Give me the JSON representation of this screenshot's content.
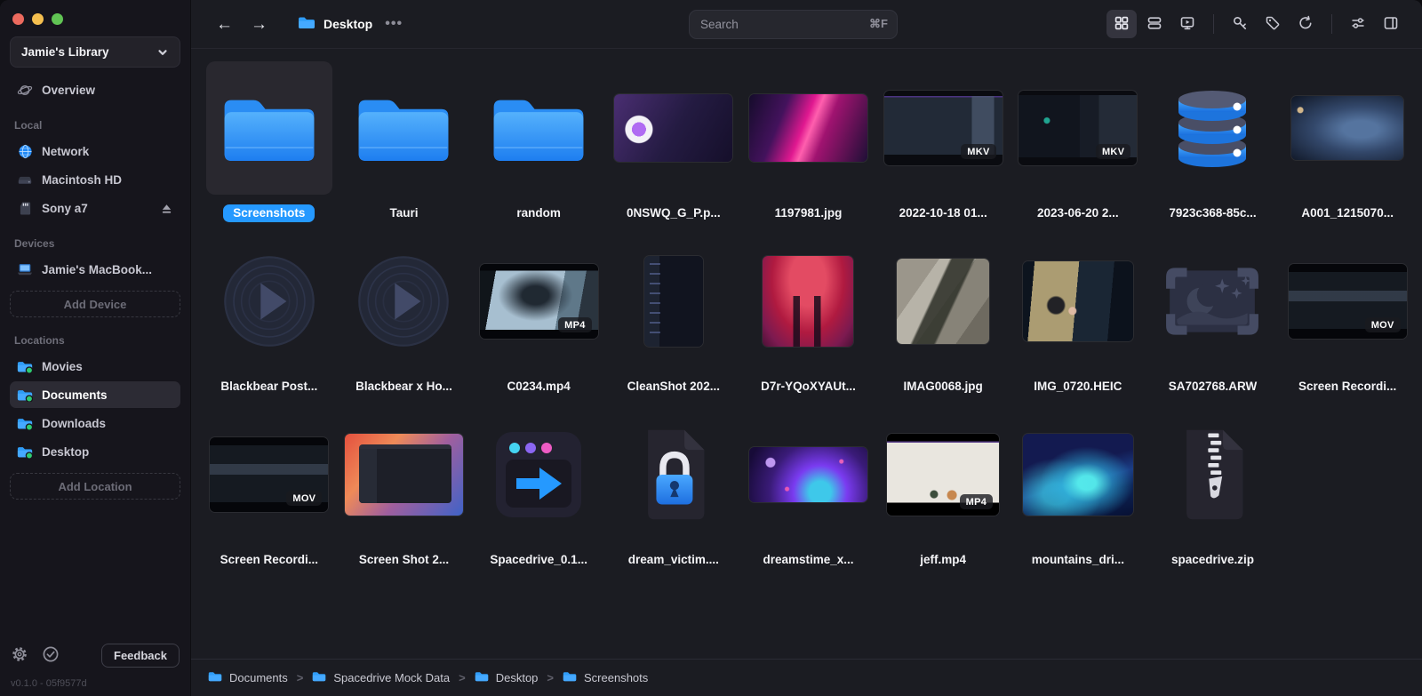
{
  "sidebar": {
    "library_name": "Jamie's Library",
    "overview_label": "Overview",
    "sections": {
      "local": {
        "title": "Local",
        "items": [
          {
            "label": "Network",
            "icon": "globe-icon"
          },
          {
            "label": "Macintosh HD",
            "icon": "hard-drive-icon"
          },
          {
            "label": "Sony a7",
            "icon": "sd-card-icon",
            "trailing_icon": "eject-icon"
          }
        ]
      },
      "devices": {
        "title": "Devices",
        "items": [
          {
            "label": "Jamie's MacBook...",
            "icon": "laptop-icon"
          }
        ],
        "add_button": "Add Device"
      },
      "locations": {
        "title": "Locations",
        "items": [
          {
            "label": "Movies",
            "icon": "folder-icon"
          },
          {
            "label": "Documents",
            "icon": "folder-icon",
            "selected": true
          },
          {
            "label": "Downloads",
            "icon": "folder-icon"
          },
          {
            "label": "Desktop",
            "icon": "folder-icon"
          }
        ],
        "add_button": "Add Location"
      }
    },
    "footer": {
      "feedback_label": "Feedback",
      "version": "v0.1.0 - 05f9577d"
    }
  },
  "topbar": {
    "back": "←",
    "forward": "→",
    "location_title": "Desktop",
    "more": "•••",
    "search": {
      "placeholder": "Search",
      "shortcut": "⌘F"
    },
    "view_modes": [
      {
        "name": "grid-view",
        "active": true
      },
      {
        "name": "list-view",
        "active": false
      },
      {
        "name": "media-view",
        "active": false
      }
    ],
    "tools": [
      "key",
      "tag",
      "refresh",
      "display-options",
      "inspector"
    ]
  },
  "grid": {
    "items": [
      {
        "name": "Screenshots",
        "kind": "folder",
        "icon": "folder-icon",
        "selected": true
      },
      {
        "name": "Tauri",
        "kind": "folder",
        "icon": "folder-icon"
      },
      {
        "name": "random",
        "kind": "folder",
        "icon": "folder-icon"
      },
      {
        "name": "0NSWQ_G_P.p...",
        "kind": "image",
        "thumb": "app-window-purple"
      },
      {
        "name": "1197981.jpg",
        "kind": "image",
        "thumb": "pink-abstract"
      },
      {
        "name": "2022-10-18 01...",
        "kind": "video",
        "thumb": "video-dark-app",
        "badge": "MKV"
      },
      {
        "name": "2023-06-20 2...",
        "kind": "video",
        "thumb": "video-dark-code",
        "badge": "MKV"
      },
      {
        "name": "7923c368-85c...",
        "kind": "database",
        "icon": "database-icon"
      },
      {
        "name": "A001_1215070...",
        "kind": "image",
        "thumb": "photo-desk-blue"
      },
      {
        "name": "Blackbear Post...",
        "kind": "audio",
        "icon": "vinyl-play-icon"
      },
      {
        "name": "Blackbear x Ho...",
        "kind": "audio",
        "icon": "vinyl-play-icon"
      },
      {
        "name": "C0234.mp4",
        "kind": "video",
        "thumb": "video-face",
        "badge": "MP4"
      },
      {
        "name": "CleanShot 202...",
        "kind": "image",
        "thumb": "screenshot-code-tall"
      },
      {
        "name": "D7r-YQoXYAUt...",
        "kind": "image",
        "thumb": "art-red"
      },
      {
        "name": "IMAG0068.jpg",
        "kind": "image",
        "thumb": "photo-cannon"
      },
      {
        "name": "IMG_0720.HEIC",
        "kind": "image",
        "thumb": "photo-rotated"
      },
      {
        "name": "SA702768.ARW",
        "kind": "raw-image",
        "icon": "raw-image-icon"
      },
      {
        "name": "Screen Recordi...",
        "kind": "video",
        "thumb": "video-screenrec",
        "badge": "MOV"
      },
      {
        "name": "Screen Recordi...",
        "kind": "video",
        "thumb": "video-screenrec",
        "badge": "MOV"
      },
      {
        "name": "Screen Shot 2...",
        "kind": "image",
        "thumb": "screenshot-bigsur"
      },
      {
        "name": "Spacedrive_0.1...",
        "kind": "disk-image",
        "icon": "disk-image-icon"
      },
      {
        "name": "dream_victim....",
        "kind": "encrypted",
        "icon": "encrypted-file-icon"
      },
      {
        "name": "dreamstime_x...",
        "kind": "image",
        "thumb": "art-space"
      },
      {
        "name": "jeff.mp4",
        "kind": "video",
        "thumb": "video-room",
        "badge": "MP4"
      },
      {
        "name": "mountains_dri...",
        "kind": "image",
        "thumb": "art-mountains"
      },
      {
        "name": "spacedrive.zip",
        "kind": "archive",
        "icon": "zip-file-icon"
      }
    ]
  },
  "pathbar": {
    "separator": ">",
    "crumbs": [
      "Documents",
      "Spacedrive Mock Data",
      "Desktop",
      "Screenshots"
    ]
  },
  "colors": {
    "accent": "#2599ff",
    "folder_blue": "#2f9cf7",
    "sidebar_bg": "#16151c",
    "main_bg": "#1b1c22",
    "location_dot_green": "#2ecc71"
  }
}
